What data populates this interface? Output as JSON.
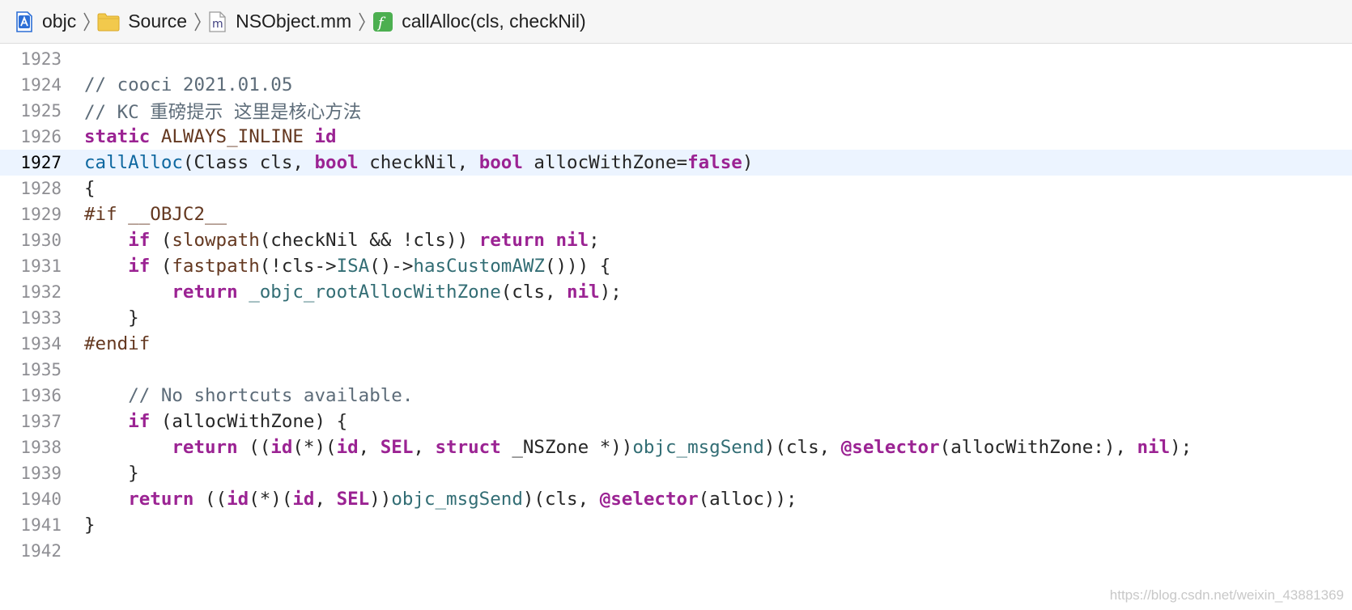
{
  "breadcrumb": {
    "items": [
      {
        "label": "objc",
        "icon": "xcode-project-icon"
      },
      {
        "label": "Source",
        "icon": "folder-icon"
      },
      {
        "label": "NSObject.mm",
        "icon": "objc-file-icon",
        "icon_glyph": "m"
      },
      {
        "label": "callAlloc(cls, checkNil)",
        "icon": "function-icon",
        "icon_glyph": "f"
      }
    ]
  },
  "colors": {
    "keyword": "#9b2393",
    "comment": "#5d6c79",
    "preprocessor": "#643820",
    "function": "#326d74",
    "declaration": "#0f68a0",
    "current_line": "#ecf4ff",
    "folder": "#f2c94c",
    "function_badge": "#4caf50",
    "project": "#2d6fd6"
  },
  "editor": {
    "current_line": 1927,
    "lines": [
      {
        "num": "1923",
        "tokens": []
      },
      {
        "num": "1924",
        "tokens": [
          [
            "cmt",
            "// cooci 2021.01.05"
          ]
        ]
      },
      {
        "num": "1925",
        "tokens": [
          [
            "cmt",
            "// KC 重磅提示 这里是核心方法"
          ]
        ]
      },
      {
        "num": "1926",
        "tokens": [
          [
            "kw",
            "static"
          ],
          [
            "plain",
            " "
          ],
          [
            "mac",
            "ALWAYS_INLINE"
          ],
          [
            "plain",
            " "
          ],
          [
            "kw",
            "id"
          ]
        ]
      },
      {
        "num": "1927",
        "tokens": [
          [
            "decl",
            "callAlloc"
          ],
          [
            "plain",
            "(Class cls, "
          ],
          [
            "kw",
            "bool"
          ],
          [
            "plain",
            " checkNil, "
          ],
          [
            "kw",
            "bool"
          ],
          [
            "plain",
            " allocWithZone="
          ],
          [
            "lit",
            "false"
          ],
          [
            "plain",
            ")"
          ]
        ]
      },
      {
        "num": "1928",
        "tokens": [
          [
            "plain",
            "{"
          ]
        ]
      },
      {
        "num": "1929",
        "tokens": [
          [
            "mac",
            "#if __OBJC2__"
          ]
        ]
      },
      {
        "num": "1930",
        "tokens": [
          [
            "plain",
            "    "
          ],
          [
            "kw",
            "if"
          ],
          [
            "plain",
            " ("
          ],
          [
            "mac",
            "slowpath"
          ],
          [
            "plain",
            "(checkNil && !cls)) "
          ],
          [
            "kw",
            "return"
          ],
          [
            "plain",
            " "
          ],
          [
            "lit",
            "nil"
          ],
          [
            "plain",
            ";"
          ]
        ]
      },
      {
        "num": "1931",
        "tokens": [
          [
            "plain",
            "    "
          ],
          [
            "kw",
            "if"
          ],
          [
            "plain",
            " ("
          ],
          [
            "mac",
            "fastpath"
          ],
          [
            "plain",
            "(!cls->"
          ],
          [
            "fn",
            "ISA"
          ],
          [
            "plain",
            "()->"
          ],
          [
            "fn",
            "hasCustomAWZ"
          ],
          [
            "plain",
            "())) {"
          ]
        ]
      },
      {
        "num": "1932",
        "tokens": [
          [
            "plain",
            "        "
          ],
          [
            "kw",
            "return"
          ],
          [
            "plain",
            " "
          ],
          [
            "fn",
            "_objc_rootAllocWithZone"
          ],
          [
            "plain",
            "(cls, "
          ],
          [
            "lit",
            "nil"
          ],
          [
            "plain",
            ");"
          ]
        ]
      },
      {
        "num": "1933",
        "tokens": [
          [
            "plain",
            "    }"
          ]
        ]
      },
      {
        "num": "1934",
        "tokens": [
          [
            "mac",
            "#endif"
          ]
        ]
      },
      {
        "num": "1935",
        "tokens": []
      },
      {
        "num": "1936",
        "tokens": [
          [
            "plain",
            "    "
          ],
          [
            "cmt",
            "// No shortcuts available."
          ]
        ]
      },
      {
        "num": "1937",
        "tokens": [
          [
            "plain",
            "    "
          ],
          [
            "kw",
            "if"
          ],
          [
            "plain",
            " (allocWithZone) {"
          ]
        ]
      },
      {
        "num": "1938",
        "tokens": [
          [
            "plain",
            "        "
          ],
          [
            "kw",
            "return"
          ],
          [
            "plain",
            " (("
          ],
          [
            "kw",
            "id"
          ],
          [
            "plain",
            "(*)("
          ],
          [
            "kw",
            "id"
          ],
          [
            "plain",
            ", "
          ],
          [
            "kw",
            "SEL"
          ],
          [
            "plain",
            ", "
          ],
          [
            "kw",
            "struct"
          ],
          [
            "plain",
            " _NSZone *))"
          ],
          [
            "fn",
            "objc_msgSend"
          ],
          [
            "plain",
            ")(cls, "
          ],
          [
            "kw",
            "@selector"
          ],
          [
            "plain",
            "(allocWithZone:), "
          ],
          [
            "lit",
            "nil"
          ],
          [
            "plain",
            ");"
          ]
        ]
      },
      {
        "num": "1939",
        "tokens": [
          [
            "plain",
            "    }"
          ]
        ]
      },
      {
        "num": "1940",
        "tokens": [
          [
            "plain",
            "    "
          ],
          [
            "kw",
            "return"
          ],
          [
            "plain",
            " (("
          ],
          [
            "kw",
            "id"
          ],
          [
            "plain",
            "(*)("
          ],
          [
            "kw",
            "id"
          ],
          [
            "plain",
            ", "
          ],
          [
            "kw",
            "SEL"
          ],
          [
            "plain",
            "))"
          ],
          [
            "fn",
            "objc_msgSend"
          ],
          [
            "plain",
            ")(cls, "
          ],
          [
            "kw",
            "@selector"
          ],
          [
            "plain",
            "(alloc));"
          ]
        ]
      },
      {
        "num": "1941",
        "tokens": [
          [
            "plain",
            "}"
          ]
        ]
      },
      {
        "num": "1942",
        "tokens": []
      }
    ]
  },
  "watermark": "https://blog.csdn.net/weixin_43881369"
}
